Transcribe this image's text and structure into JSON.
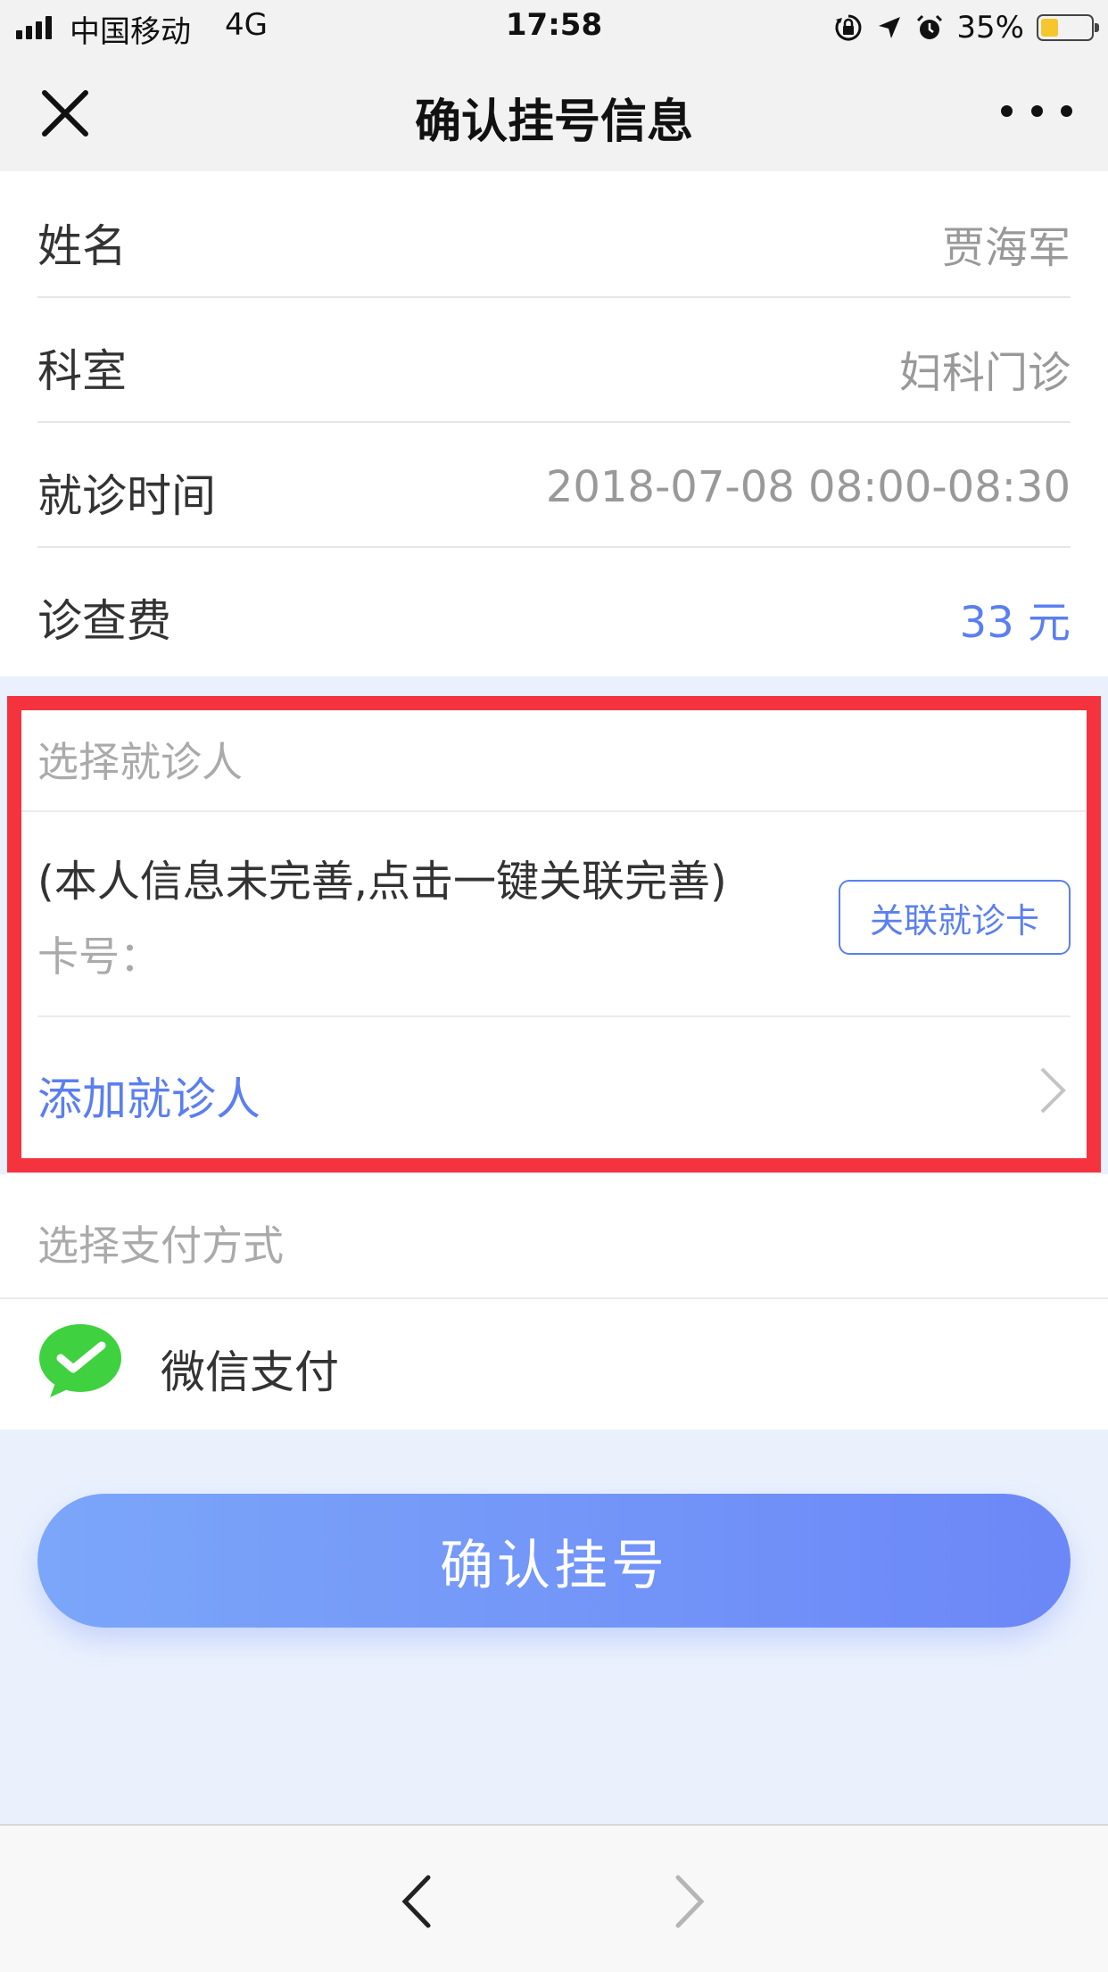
{
  "status_bar": {
    "carrier": "中国移动",
    "network": "4G",
    "time": "17:58",
    "battery_percent": "35%",
    "battery_level": 0.35,
    "icons": [
      "orientation-lock-icon",
      "location-arrow-icon",
      "alarm-clock-icon",
      "battery-icon"
    ]
  },
  "nav": {
    "title": "确认挂号信息",
    "close_icon": "close-icon",
    "more_icon": "more-icon"
  },
  "info": {
    "rows": [
      {
        "label": "姓名",
        "value": "贾海军"
      },
      {
        "label": "科室",
        "value": "妇科门诊"
      },
      {
        "label": "就诊时间",
        "value": "2018-07-08 08:00-08:30"
      },
      {
        "label": "诊查费",
        "value": "33 元"
      }
    ]
  },
  "patient": {
    "section_title": "选择就诊人",
    "info_text": "(本人信息未完善,点击一键关联完善)",
    "card_no_label": "卡号：",
    "link_card_button": "关联就诊卡",
    "add_patient": "添加就诊人"
  },
  "payment": {
    "section_title": "选择支付方式",
    "method": "微信支付",
    "method_icon": "wechat-pay-icon"
  },
  "confirm_button": "确认挂号",
  "colors": {
    "accent": "#5b7ff0",
    "highlight": "#f5333f",
    "wechat_green": "#3fd13f",
    "page_bg": "#eaf1fd"
  }
}
